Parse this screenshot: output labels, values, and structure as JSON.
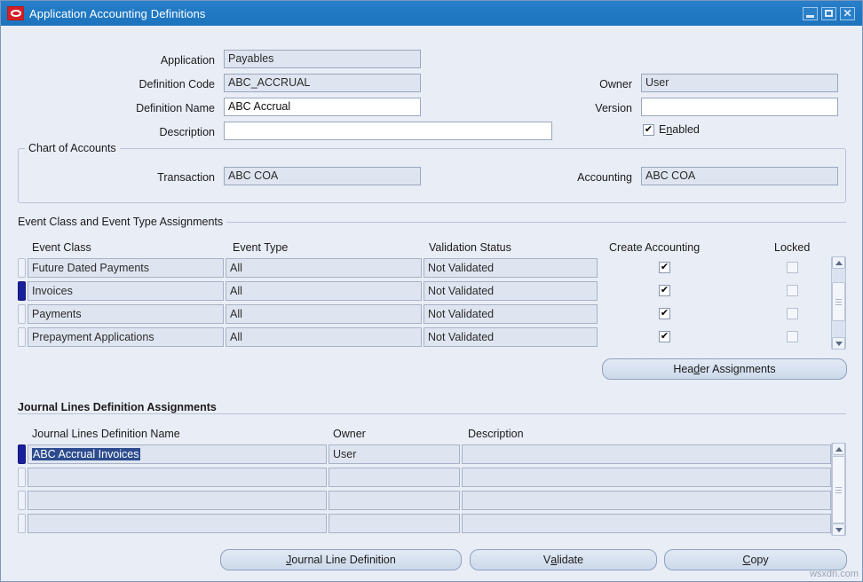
{
  "window": {
    "title": "Application Accounting Definitions",
    "logo_icon": "oracle-logo-icon",
    "minimize_label": "",
    "maximize_label": "",
    "close_label": "✕"
  },
  "header_form": {
    "application": {
      "label": "Application",
      "value": "Payables",
      "readonly": true
    },
    "definition_code": {
      "label": "Definition Code",
      "value": "ABC_ACCRUAL",
      "readonly": true
    },
    "definition_name": {
      "label": "Definition Name",
      "value": "ABC Accrual",
      "readonly": false
    },
    "description": {
      "label": "Description",
      "value": "",
      "readonly": false
    },
    "owner": {
      "label": "Owner",
      "value": "User",
      "readonly": true
    },
    "version": {
      "label": "Version",
      "value": "",
      "readonly": false
    },
    "enabled": {
      "label_pre": "E",
      "label_mnemonic": "n",
      "label_post": "abled",
      "checked": true,
      "check_glyph": "✔"
    }
  },
  "chart_of_accounts": {
    "title": "Chart of Accounts",
    "transaction": {
      "label": "Transaction",
      "value": "ABC COA"
    },
    "accounting": {
      "label": "Accounting",
      "value": "ABC COA"
    }
  },
  "event_assignments": {
    "title": "Event Class and Event Type Assignments",
    "columns": [
      "Event Class",
      "Event Type",
      "Validation Status",
      "Create Accounting",
      "Locked"
    ],
    "check_glyph": "✔",
    "rows": [
      {
        "event_class": "Future Dated Payments",
        "event_type": "All",
        "validation_status": "Not Validated",
        "create_accounting": true,
        "locked": false,
        "current": false
      },
      {
        "event_class": "Invoices",
        "event_type": "All",
        "validation_status": "Not Validated",
        "create_accounting": true,
        "locked": false,
        "current": true
      },
      {
        "event_class": "Payments",
        "event_type": "All",
        "validation_status": "Not Validated",
        "create_accounting": true,
        "locked": false,
        "current": false
      },
      {
        "event_class": "Prepayment Applications",
        "event_type": "All",
        "validation_status": "Not Validated",
        "create_accounting": true,
        "locked": false,
        "current": false
      }
    ],
    "header_assignments_button": {
      "pre": "Hea",
      "mnemonic": "d",
      "post": "er Assignments"
    }
  },
  "journal_lines": {
    "title": "Journal Lines Definition Assignments",
    "columns": [
      "Journal Lines Definition Name",
      "Owner",
      "Description"
    ],
    "rows": [
      {
        "name": "ABC Accrual Invoices",
        "owner": "User",
        "description": "",
        "current": true,
        "name_selected": true
      },
      {
        "name": "",
        "owner": "",
        "description": "",
        "current": false,
        "name_selected": false
      },
      {
        "name": "",
        "owner": "",
        "description": "",
        "current": false,
        "name_selected": false
      },
      {
        "name": "",
        "owner": "",
        "description": "",
        "current": false,
        "name_selected": false
      }
    ]
  },
  "footer_buttons": [
    {
      "pre": "",
      "mnemonic": "J",
      "post": "ournal Line Definition"
    },
    {
      "pre": "V",
      "mnemonic": "a",
      "post": "lidate"
    },
    {
      "pre": "",
      "mnemonic": "C",
      "post": "opy"
    }
  ],
  "watermark": "wsxdn.com",
  "colors": {
    "titlebar": "#2079c4",
    "window_bg": "#e9edf6",
    "field_readonly_bg": "#dfe5f0",
    "field_edit_bg": "#ffffff",
    "selection_bg": "#2d4c8f",
    "current_record": "#1a1f9c",
    "logo_red": "#d31f26"
  }
}
